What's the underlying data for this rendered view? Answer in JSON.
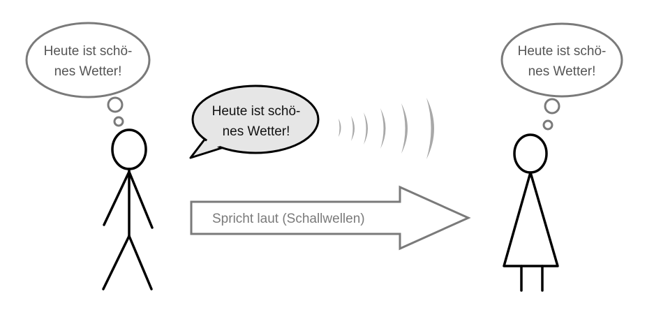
{
  "thought_left": {
    "line1": "Heute ist schö-",
    "line2": "nes Wetter!"
  },
  "thought_right": {
    "line1": "Heute ist schö-",
    "line2": "nes Wetter!"
  },
  "speech": {
    "line1": "Heute ist schö-",
    "line2": "nes Wetter!"
  },
  "arrow": {
    "label": "Spricht laut (Schallwellen)"
  },
  "colors": {
    "outline_grey": "#7a7a7a",
    "speech_fill": "#e6e6e6",
    "wave_grey": "#a8a8a8",
    "figure_black": "#000000"
  }
}
